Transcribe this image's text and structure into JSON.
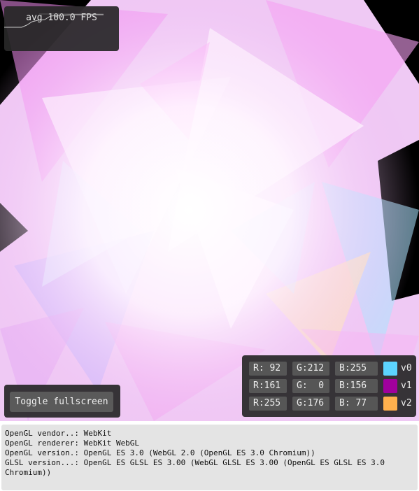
{
  "fps_panel": {
    "label": "avg 100.0 FPS"
  },
  "fullscreen_button": {
    "label": "Toggle fullscreen"
  },
  "color_panel": {
    "rows": [
      {
        "r": "R: 92",
        "g": "G:212",
        "b": "B:255",
        "label": "v0",
        "color": "#5cd4ff"
      },
      {
        "r": "R:161",
        "g": "G:  0",
        "b": "B:156",
        "label": "v1",
        "color": "#a1009c"
      },
      {
        "r": "R:255",
        "g": "G:176",
        "b": "B: 77",
        "label": "v2",
        "color": "#ffb04d"
      }
    ]
  },
  "gl_info": {
    "vendor": "OpenGL vendor..: WebKit",
    "renderer": "OpenGL renderer: WebKit WebGL",
    "version": "OpenGL version.: OpenGL ES 3.0 (WebGL 2.0 (OpenGL ES 3.0 Chromium))",
    "glsl": "GLSL version...: OpenGL ES GLSL ES 3.00 (WebGL GLSL ES 3.00 (OpenGL ES GLSL ES 3.0 Chromium))"
  }
}
